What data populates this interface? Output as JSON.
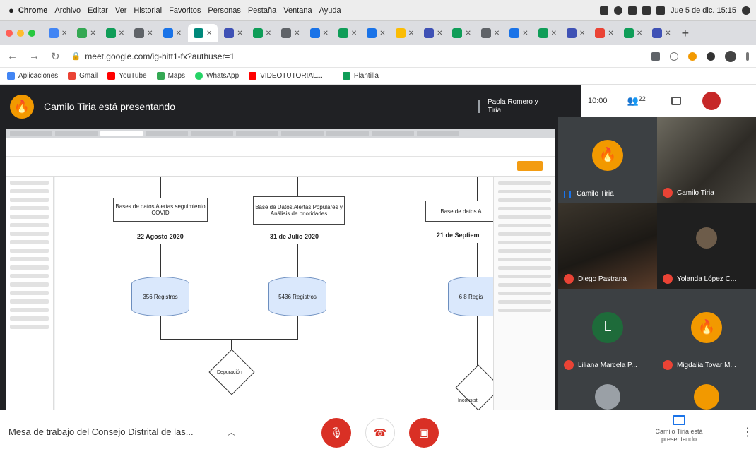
{
  "menubar": {
    "app": "Chrome",
    "items": [
      "Archivo",
      "Editar",
      "Ver",
      "Historial",
      "Favoritos",
      "Personas",
      "Pestaña",
      "Ventana",
      "Ayuda"
    ],
    "date": "Jue 5 de dic.  15:15"
  },
  "browser": {
    "url": "meet.google.com/ig-hitt1-fx?authuser=1",
    "bookmarks": [
      {
        "label": "Aplicaciones",
        "color": "#4285f4"
      },
      {
        "label": "Gmail",
        "color": "#ea4335"
      },
      {
        "label": "YouTube",
        "color": "#ff0000"
      },
      {
        "label": "Maps",
        "color": "#34a853"
      },
      {
        "label": "WhatsApp",
        "color": "#25d366"
      },
      {
        "label": "VIDEOTUTORIAL...",
        "color": "#ff0000"
      },
      {
        "label": "Plantilla",
        "color": "#0f9d58"
      }
    ]
  },
  "meet": {
    "presenting_title": "Camilo Tiria está presentando",
    "recording_name": "Paola Romero y Tiria",
    "time": "10:00",
    "participants_count": "22",
    "meeting_title": "Mesa de trabajo del Consejo Distrital de las...",
    "presenting_status": "Camilo Tiria está presentando"
  },
  "participants": [
    {
      "name": "Camilo Tiria",
      "speaking": true
    },
    {
      "name": "Camilo Tiria",
      "speaking": false
    },
    {
      "name": "Diego Pastrana",
      "speaking": false
    },
    {
      "name": "Yolanda López C...",
      "speaking": false
    },
    {
      "name": "Liliana Marcela P...",
      "initial": "L",
      "speaking": false
    },
    {
      "name": "Migdalia Tovar M...",
      "speaking": false
    }
  ],
  "diagram": {
    "sources": [
      "Bases de datos Alertas seguimiento COVID",
      "Base de Datos Alertas Populares y Análisis de prioridades",
      "Base de datos A"
    ],
    "dates": [
      "22 Agosto 2020",
      "31 de Julio 2020",
      "21 de Septiem"
    ],
    "registers": [
      "356 Registros",
      "5436 Registros",
      "6 8 Regis"
    ],
    "decision": "Depuración",
    "bottom_right": "Inconsist"
  }
}
